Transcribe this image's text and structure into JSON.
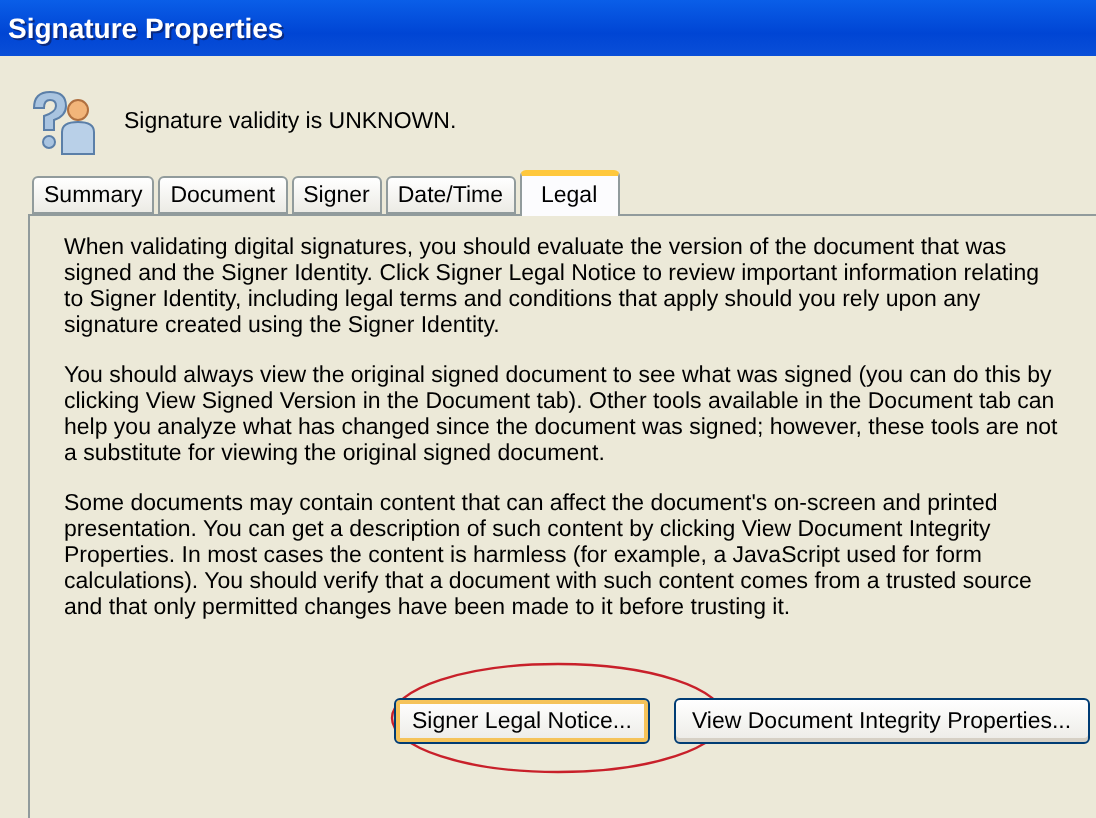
{
  "window": {
    "title": "Signature Properties"
  },
  "status": {
    "text": "Signature validity is UNKNOWN."
  },
  "tabs": [
    {
      "label": "Summary",
      "selected": false
    },
    {
      "label": "Document",
      "selected": false
    },
    {
      "label": "Signer",
      "selected": false
    },
    {
      "label": "Date/Time",
      "selected": false
    },
    {
      "label": "Legal",
      "selected": true
    }
  ],
  "paragraphs": [
    "When validating digital signatures, you should evaluate the version of the document that was signed and the Signer Identity. Click Signer Legal Notice to review important information relating to Signer Identity, including legal terms and conditions that apply should you rely upon any signature created using the Signer Identity.",
    "You should always view the original signed document to see what was signed (you can do this by clicking View Signed Version in the Document tab). Other tools available in the Document tab can help you analyze what has changed since the document was signed; however, these tools are not a substitute for viewing the original signed document.",
    "Some documents may contain content that can affect the document's on-screen and printed presentation. You can get a description of such content by clicking View Document Integrity Properties. In most cases the content is harmless (for example, a JavaScript used for form calculations). You should verify that a document with such content comes from a trusted source and that only permitted changes have been made to it before trusting it."
  ],
  "buttons": [
    {
      "label": "Signer Legal Notice...",
      "default": true,
      "circled": true
    },
    {
      "label": "View Document Integrity Properties...",
      "default": false,
      "circled": false
    }
  ]
}
